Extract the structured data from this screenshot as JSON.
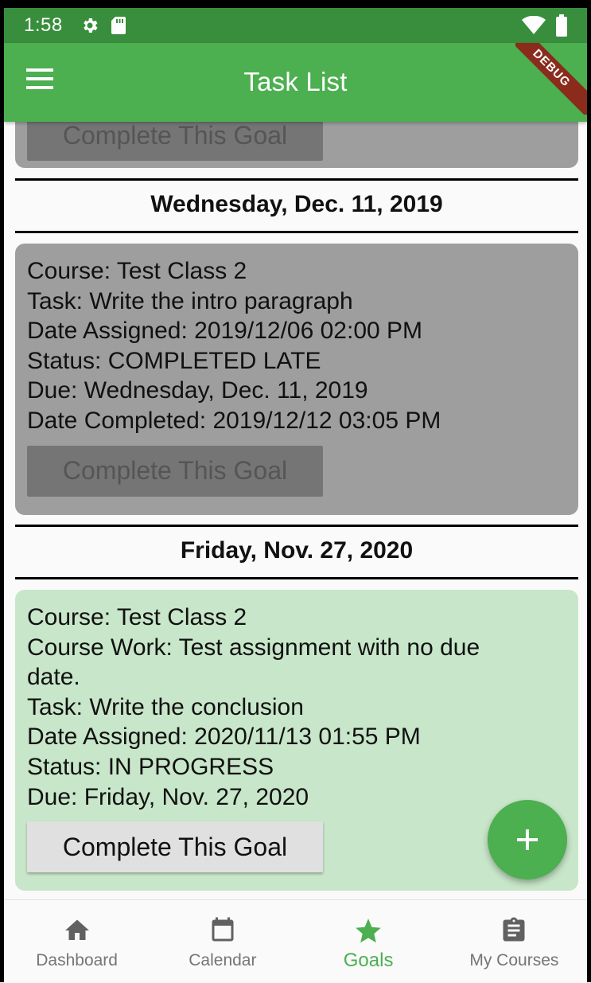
{
  "status_bar": {
    "time": "1:58"
  },
  "app_bar": {
    "title": "Task List",
    "debug_label": "DEBUG"
  },
  "cards": [
    {
      "style": "gray",
      "lines": [],
      "button_label": "Complete This Goal",
      "button_enabled": false
    },
    {
      "style": "gray",
      "lines": [
        "Course: Test Class 2",
        "Task: Write the intro paragraph",
        "Date Assigned: 2019/12/06 02:00 PM",
        "Status: COMPLETED LATE",
        "Due: Wednesday, Dec. 11, 2019",
        "Date Completed: 2019/12/12 03:05 PM"
      ],
      "button_label": "Complete This Goal",
      "button_enabled": false
    },
    {
      "style": "green",
      "lines": [
        "Course: Test Class 2",
        "Course Work: Test assignment with no due\ndate.",
        "Task: Write the conclusion",
        "Date Assigned: 2020/11/13 01:55 PM",
        "Status: IN PROGRESS",
        "Due: Friday, Nov. 27, 2020"
      ],
      "button_label": "Complete This Goal",
      "button_enabled": true
    }
  ],
  "date_headers": [
    "Wednesday, Dec. 11, 2019",
    "Friday, Nov. 27, 2020"
  ],
  "fab": {
    "icon": "plus-icon"
  },
  "bottom_nav": {
    "items": [
      {
        "label": "Dashboard",
        "icon": "home-icon"
      },
      {
        "label": "Calendar",
        "icon": "calendar-icon"
      },
      {
        "label": "Goals",
        "icon": "star-icon",
        "active": true
      },
      {
        "label": "My Courses",
        "icon": "clipboard-icon"
      }
    ]
  },
  "colors": {
    "primary": "#4caf50",
    "status_bar": "#388e3c",
    "card_gray": "#9e9e9e",
    "card_green": "#c8e6c9",
    "debug": "#8b2b1c"
  }
}
